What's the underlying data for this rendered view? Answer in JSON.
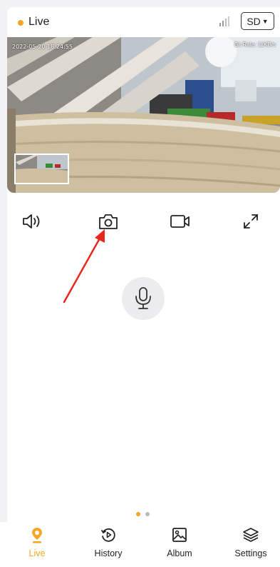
{
  "header": {
    "status_label": "Live",
    "quality_label": "SD",
    "accent_color": "#f6a623"
  },
  "video": {
    "timestamp": "2022-05-20 18:24:55",
    "bitrate": "Bit Rate: 11KB/s"
  },
  "controls": {
    "items": [
      {
        "name": "speaker-icon"
      },
      {
        "name": "camera-icon"
      },
      {
        "name": "video-record-icon"
      },
      {
        "name": "fullscreen-icon"
      }
    ],
    "mic_icon": "microphone-icon"
  },
  "pager": {
    "active_page": 1,
    "total_pages": 2
  },
  "tabbar": {
    "tabs": [
      {
        "label": "Live",
        "icon": "live-pin-icon",
        "active": true
      },
      {
        "label": "History",
        "icon": "history-icon",
        "active": false
      },
      {
        "label": "Album",
        "icon": "album-icon",
        "active": false
      },
      {
        "label": "Settings",
        "icon": "settings-layers-icon",
        "active": false
      }
    ]
  }
}
